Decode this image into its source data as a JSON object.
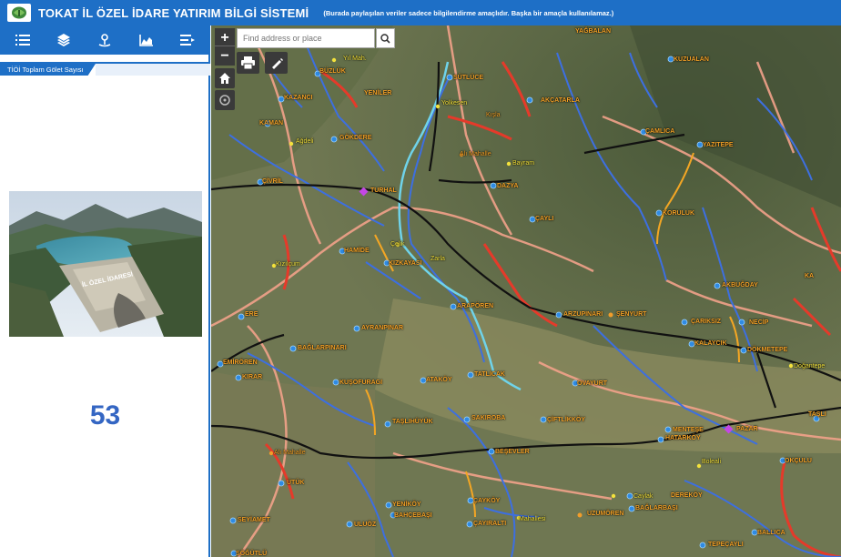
{
  "header": {
    "title": "TOKAT İL ÖZEL İDARE YATIRIM BİLGİ SİSTEMİ",
    "note": "(Burada paylaşılan veriler sadece bilgilendirme amaçlıdır. Başka bir amaçla kullanılamaz.)",
    "logo_icon": "province-emblem-icon"
  },
  "toolbar": {
    "items": [
      "list-icon",
      "layers-icon",
      "bookmark-pin-icon",
      "chart-icon",
      "query-list-icon"
    ]
  },
  "panel": {
    "tab_label": "TİÖİ Toplam Gölet Sayısı",
    "count": "53",
    "image_caption": "İL ÖZEL İDARESİ"
  },
  "map": {
    "search_placeholder": "Find address or place",
    "zoom_in": "+",
    "zoom_out": "−",
    "places": [
      {
        "name": "YAĞBALAN",
        "cls": ""
      },
      {
        "name": "KUZUALAN",
        "cls": ""
      },
      {
        "name": "Yıl Mah.",
        "cls": "yellow dim"
      },
      {
        "name": "BÜZLÜK",
        "cls": ""
      },
      {
        "name": "SÜTLÜCE",
        "cls": ""
      },
      {
        "name": "YENİLER",
        "cls": ""
      },
      {
        "name": "AKÇATARLA",
        "cls": ""
      },
      {
        "name": "KAZANCI",
        "cls": ""
      },
      {
        "name": "Yolkesen",
        "cls": "yellow dim"
      },
      {
        "name": "Kışla",
        "cls": "dim"
      },
      {
        "name": "KAMAN",
        "cls": ""
      },
      {
        "name": "ÇAMLICA",
        "cls": ""
      },
      {
        "name": "Ağdeli",
        "cls": "yellow dim"
      },
      {
        "name": "GÖKDERE",
        "cls": ""
      },
      {
        "name": "YAZITEPE",
        "cls": ""
      },
      {
        "name": "Alı Mahalle",
        "cls": "dim"
      },
      {
        "name": "Bayram",
        "cls": "yellow dim"
      },
      {
        "name": "DAZYA",
        "cls": ""
      },
      {
        "name": "ÇİVRİL",
        "cls": ""
      },
      {
        "name": "TURHAL",
        "cls": ""
      },
      {
        "name": "KORULUK",
        "cls": ""
      },
      {
        "name": "ÇAYLI",
        "cls": ""
      },
      {
        "name": "Çelik",
        "cls": "yellow dim"
      },
      {
        "name": "HAMİDE",
        "cls": ""
      },
      {
        "name": "Zarla",
        "cls": "yellow dim"
      },
      {
        "name": "KIZKAYASI",
        "cls": ""
      },
      {
        "name": "Kızılçum",
        "cls": "yellow dim"
      },
      {
        "name": "AKBUĞDAY",
        "cls": ""
      },
      {
        "name": "ARAPÖREN",
        "cls": ""
      },
      {
        "name": "ERE",
        "cls": ""
      },
      {
        "name": "ARZUPINARI",
        "cls": ""
      },
      {
        "name": "ŞENYURT",
        "cls": ""
      },
      {
        "name": "ÇARIKSIZ",
        "cls": ""
      },
      {
        "name": "NECİP",
        "cls": ""
      },
      {
        "name": "AYRANPINAR",
        "cls": ""
      },
      {
        "name": "KALAYCIK",
        "cls": ""
      },
      {
        "name": "DÖKMETEPE",
        "cls": ""
      },
      {
        "name": "BAĞLARPINARI",
        "cls": ""
      },
      {
        "name": "Doğantepe",
        "cls": "yellow dim"
      },
      {
        "name": "EMİRÖREN",
        "cls": ""
      },
      {
        "name": "KIRAR",
        "cls": ""
      },
      {
        "name": "TATLICAK",
        "cls": ""
      },
      {
        "name": "KUŞOFURAGI",
        "cls": ""
      },
      {
        "name": "ATAKÖY",
        "cls": ""
      },
      {
        "name": "OVAYURT",
        "cls": ""
      },
      {
        "name": "TAŞLIHÜYÜK",
        "cls": ""
      },
      {
        "name": "SAKIROBA",
        "cls": ""
      },
      {
        "name": "ÇİFTLİKKÖY",
        "cls": ""
      },
      {
        "name": "MENTEŞE",
        "cls": ""
      },
      {
        "name": "PAZAR",
        "cls": ""
      },
      {
        "name": "HATARKÖY",
        "cls": ""
      },
      {
        "name": "TAŞLI",
        "cls": ""
      },
      {
        "name": "Alı Mahalle",
        "cls": "dim"
      },
      {
        "name": "BEŞEVLER",
        "cls": ""
      },
      {
        "name": "Boleali",
        "cls": "yellow dim"
      },
      {
        "name": "OKÇULU",
        "cls": ""
      },
      {
        "name": "ÜTÜK",
        "cls": ""
      },
      {
        "name": "ÇAYKÖY",
        "cls": ""
      },
      {
        "name": "Caylak",
        "cls": "yellow dim"
      },
      {
        "name": "DEREKÖY",
        "cls": ""
      },
      {
        "name": "YENİKÖY",
        "cls": ""
      },
      {
        "name": "BAĞLARBAŞI",
        "cls": ""
      },
      {
        "name": "BAHÇEBAŞI",
        "cls": ""
      },
      {
        "name": "UZUMÖREN",
        "cls": ""
      },
      {
        "name": "SEYİAMET",
        "cls": ""
      },
      {
        "name": "ÇAYIRALTI",
        "cls": ""
      },
      {
        "name": "Mahallesi",
        "cls": "yellow dim"
      },
      {
        "name": "ULUÖZ",
        "cls": ""
      },
      {
        "name": "BALLICA",
        "cls": ""
      },
      {
        "name": "TEPEÇAYLI",
        "cls": ""
      },
      {
        "name": "SÖĞÜTLÜ",
        "cls": ""
      },
      {
        "name": "KA",
        "cls": ""
      }
    ]
  }
}
